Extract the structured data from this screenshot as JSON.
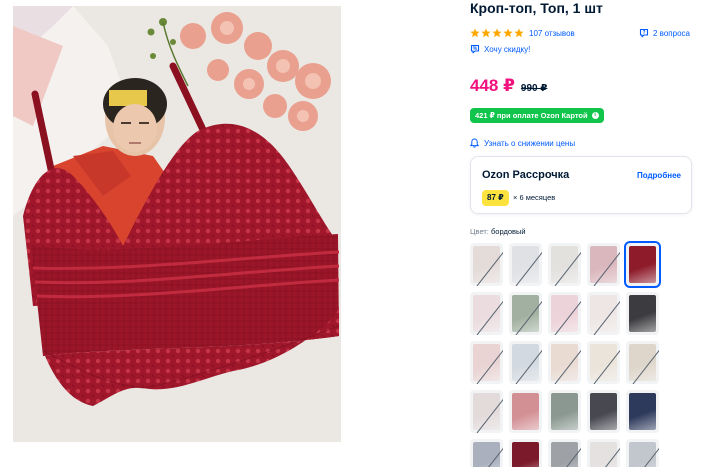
{
  "product": {
    "title": "Кроп-топ, Топ, 1 шт",
    "rating_stars": 5,
    "reviews": "107 отзывов",
    "questions": "2 вопроса",
    "discount_link": "Хочу скидку!",
    "price": "448 ₽",
    "old_price": "990 ₽",
    "card_price": "421 ₽ при оплате Ozon Картой",
    "card_info_icon": "i",
    "price_watch": "Узнать о снижении цены"
  },
  "installment": {
    "title": "Ozon Рассрочка",
    "more": "Подробнее",
    "monthly": "87 ₽",
    "term": "× 6 месяцев"
  },
  "color": {
    "label": "Цвет:",
    "value": "бордовый"
  },
  "swatches": [
    {
      "color": "#d9c8c2",
      "available": false
    },
    {
      "color": "#cfd2d6",
      "available": false
    },
    {
      "color": "#d6d2cc",
      "available": false
    },
    {
      "color": "#c7868e",
      "available": false
    },
    {
      "color": "#8e1b2a",
      "available": true,
      "selected": true
    },
    {
      "color": "#e4c9cd",
      "available": false
    },
    {
      "color": "#5f7a5a",
      "available": false
    },
    {
      "color": "#e8b7c2",
      "available": false
    },
    {
      "color": "#e9dcd6",
      "available": false
    },
    {
      "color": "#3c3c40",
      "available": true
    },
    {
      "color": "#e2b9b7",
      "available": false
    },
    {
      "color": "#b9c4cf",
      "available": false
    },
    {
      "color": "#e2c6b6",
      "available": false
    },
    {
      "color": "#e4d7c4",
      "available": false
    },
    {
      "color": "#cdbfa8",
      "available": false
    },
    {
      "color": "#d7c7c5",
      "available": false
    },
    {
      "color": "#d28f94",
      "available": true
    },
    {
      "color": "#8a9891",
      "available": true
    },
    {
      "color": "#474850",
      "available": true
    },
    {
      "color": "#2e3a5c",
      "available": true
    },
    {
      "color": "#6f7a92",
      "available": false
    },
    {
      "color": "#7b1a2a",
      "available": true
    },
    {
      "color": "#5a5f66",
      "available": false
    },
    {
      "color": "#d9d3cf",
      "available": false
    },
    {
      "color": "#9aa2ad",
      "available": false
    }
  ],
  "icons": {
    "star": "star-icon",
    "question": "question-bubble-icon",
    "discount": "discount-chat-icon",
    "bell": "bell-icon"
  },
  "colors": {
    "accent": "#005bff",
    "price": "#f1117e",
    "ozon_card": "#10c44c",
    "installment_badge": "#fee23d",
    "star": "#ffa800"
  }
}
